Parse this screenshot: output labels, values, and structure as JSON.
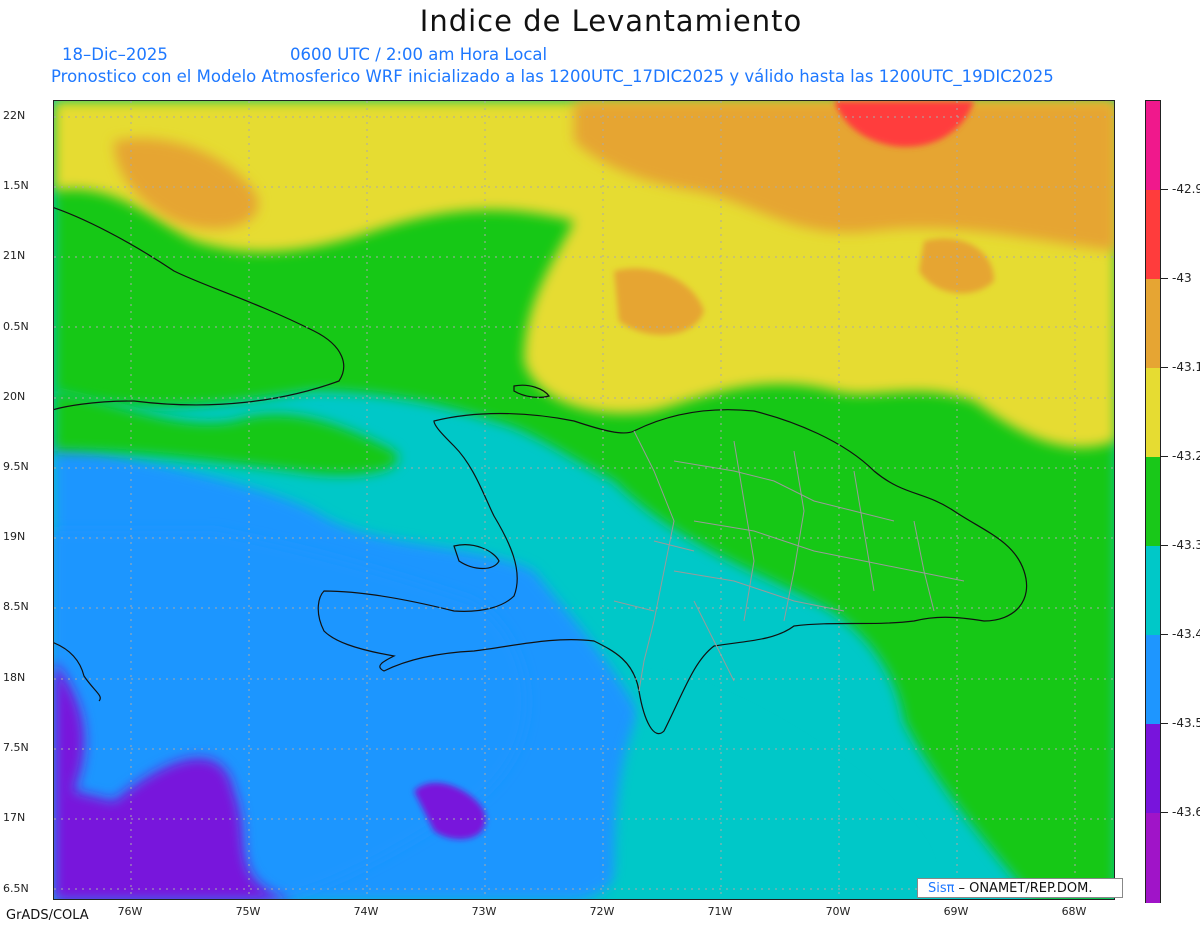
{
  "header": {
    "title": "Indice de Levantamiento",
    "date": "18–Dic–2025",
    "time": "0600 UTC / 2:00 am Hora Local",
    "subtitle": "Pronostico con el Modelo Atmosferico WRF inicializado a las 1200UTC_17DIC2025 y válido hasta las  1200UTC_19DIC2025"
  },
  "axes": {
    "lat_labels": [
      "22N",
      "1.5N",
      "21N",
      "0.5N",
      "20N",
      "9.5N",
      "19N",
      "8.5N",
      "18N",
      "7.5N",
      "17N",
      "6.5N"
    ],
    "lon_labels": [
      "76W",
      "75W",
      "74W",
      "73W",
      "72W",
      "71W",
      "70W",
      "69W",
      "68W"
    ]
  },
  "colorbar": {
    "colors": [
      "#f0188c",
      "#ff3c3c",
      "#e6a533",
      "#e6dc32",
      "#19c819",
      "#00c8c8",
      "#1e96ff",
      "#7814dc",
      "#a014c8"
    ],
    "labels": [
      "-42.9",
      "-43",
      "-43.1",
      "-43.2",
      "-43.3",
      "-43.4",
      "-43.5",
      "-43.6"
    ]
  },
  "footer": {
    "software": "GrADS/COLA",
    "credit_brand": "Sisπ",
    "credit_text": "– ONAMET/REP.DOM."
  }
}
